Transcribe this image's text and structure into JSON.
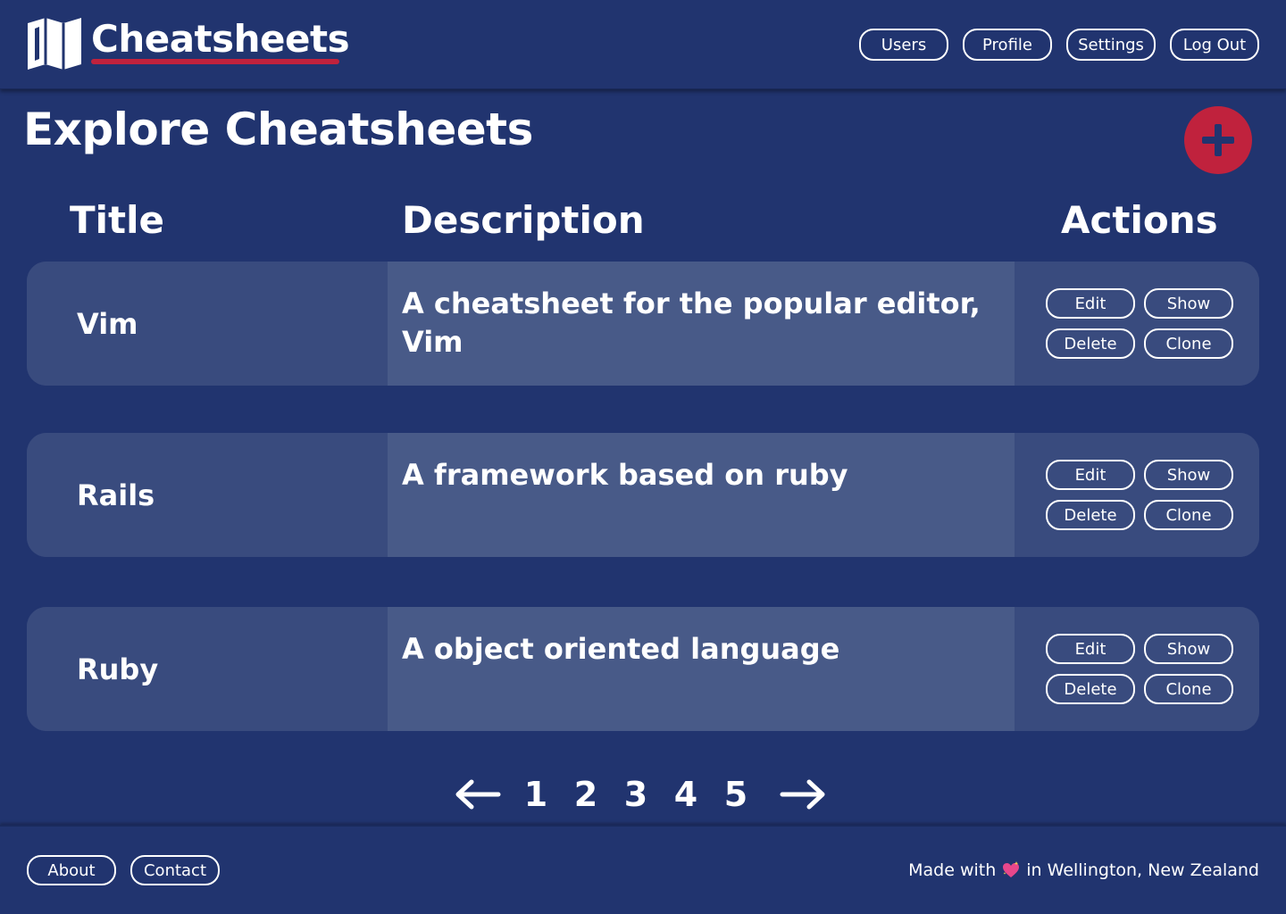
{
  "app": {
    "name": "Cheatsheets"
  },
  "nav": {
    "items": [
      {
        "label": "Users"
      },
      {
        "label": "Profile"
      },
      {
        "label": "Settings"
      },
      {
        "label": "Log Out"
      }
    ]
  },
  "page": {
    "title": "Explore Cheatsheets"
  },
  "table": {
    "headers": {
      "title": "Title",
      "description": "Description",
      "actions": "Actions"
    },
    "rows": [
      {
        "title": "Vim",
        "description": "A cheatsheet for the popular editor, Vim"
      },
      {
        "title": "Rails",
        "description": "A framework based on ruby"
      },
      {
        "title": "Ruby",
        "description": "A object oriented language"
      }
    ],
    "action_labels": {
      "edit": "Edit",
      "show": "Show",
      "delete": "Delete",
      "clone": "Clone"
    }
  },
  "pagination": {
    "pages": [
      "1",
      "2",
      "3",
      "4",
      "5"
    ]
  },
  "footer": {
    "links": [
      {
        "label": "About"
      },
      {
        "label": "Contact"
      }
    ],
    "made_with": "Made with",
    "location": "in Wellington, New Zealand"
  },
  "icons": {
    "logo": "book-map-icon",
    "add": "plus-icon",
    "prev": "arrow-left-icon",
    "next": "arrow-right-icon",
    "heart": "sparkling-heart-icon"
  },
  "colors": {
    "background": "#21346f",
    "accent": "#c0223d",
    "row_side": "#394b7e",
    "row_middle": "#485a88",
    "text": "#ffffff"
  }
}
